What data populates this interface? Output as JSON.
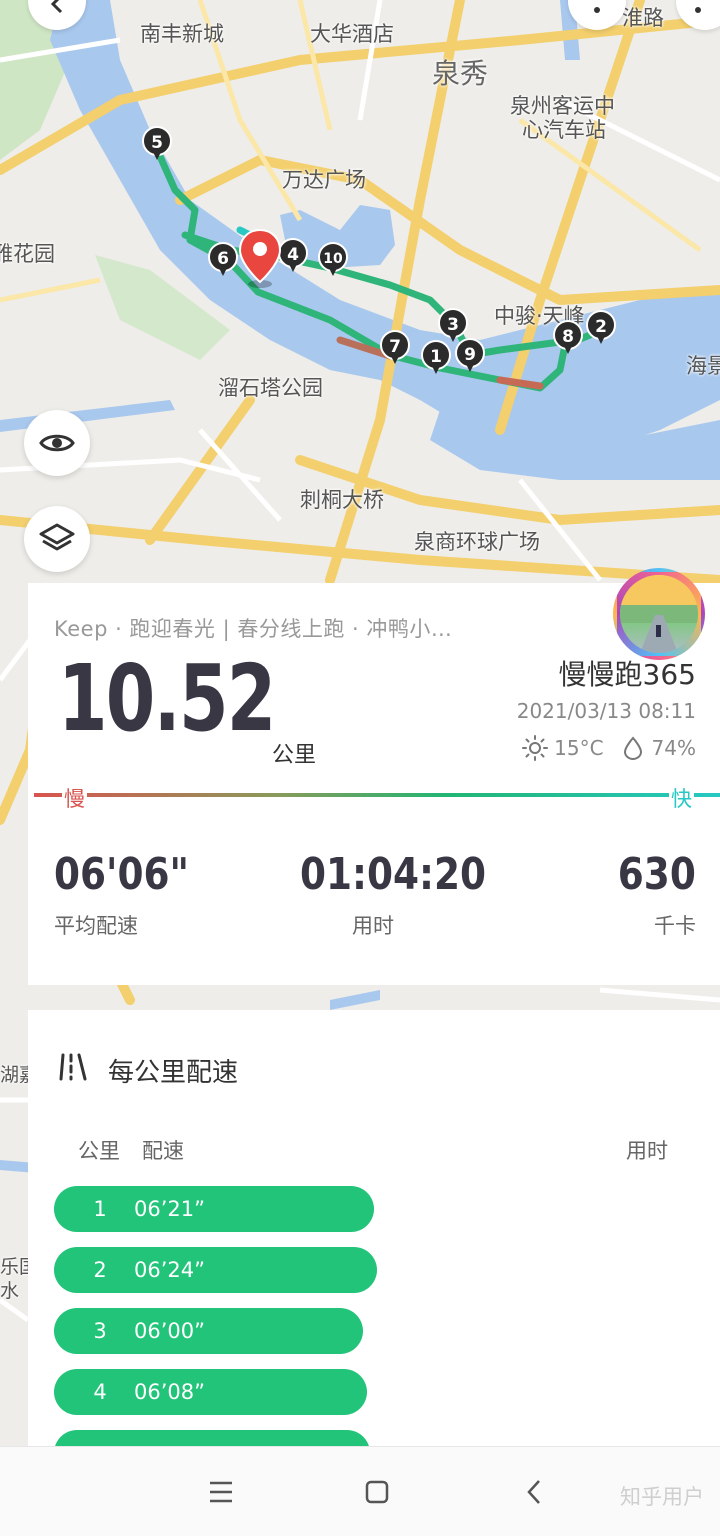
{
  "map": {
    "labels": {
      "nanfeng": "南丰新城",
      "dahua": "大华酒店",
      "quanxiu": "泉秀",
      "huai_road": "淮路",
      "bus_station_1": "泉州客运中",
      "bus_station_2": "心汽车站",
      "wanda": "万达广场",
      "huayuan": "雅花园",
      "zhongjun": "中骏·天峰",
      "haijing": "海景",
      "liushita": "溜石塔公园",
      "citong": "刺桐大桥",
      "quanshang": "泉商环球广场",
      "hujia": "湖嘉",
      "leguo": "乐国",
      "shui": "水"
    },
    "km_markers": [
      "1",
      "2",
      "3",
      "4",
      "5",
      "6",
      "7",
      "8",
      "9",
      "10"
    ]
  },
  "summary": {
    "activity_title": "Keep · 跑迎春光 | 春分线上跑 · 冲鸭小…",
    "distance": "10.52",
    "distance_unit": "公里",
    "user_name": "慢慢跑365",
    "datetime": "2021/03/13 08:11",
    "temperature": "15°C",
    "humidity": "74%",
    "pace_slow_label": "慢",
    "pace_fast_label": "快",
    "stats": {
      "avg_pace_value": "06'06\"",
      "avg_pace_label": "平均配速",
      "duration_value": "01:04:20",
      "duration_label": "用时",
      "calories_value": "630",
      "calories_label": "千卡"
    }
  },
  "splits": {
    "title": "每公里配速",
    "col_km": "公里",
    "col_pace": "配速",
    "col_time": "用时",
    "rows": [
      {
        "km": "1",
        "pace": "06’21”",
        "fraction": 0.94
      },
      {
        "km": "2",
        "pace": "06’24”",
        "fraction": 0.95
      },
      {
        "km": "3",
        "pace": "06’00”",
        "fraction": 0.91
      },
      {
        "km": "4",
        "pace": "06’08”",
        "fraction": 0.92
      }
    ]
  },
  "navbar": {
    "watermark": "知乎用户"
  },
  "colors": {
    "route": "#2fb57a",
    "split_bar": "#22c47a",
    "water": "#a9c8ee",
    "pace_slow": "#d9534f",
    "pace_fast": "#26c9c3"
  }
}
